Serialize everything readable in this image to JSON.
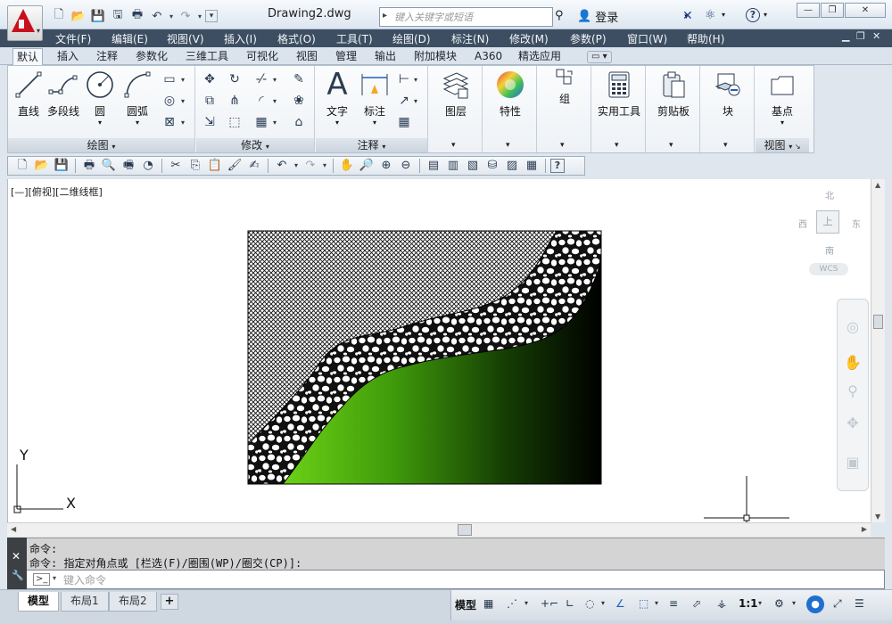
{
  "window": {
    "title": "Drawing2.dwg",
    "minimize": "—",
    "restore": "❐",
    "close": "✕"
  },
  "search": {
    "placeholder": "键入关键字或短语"
  },
  "user": {
    "login": "登录"
  },
  "menu": [
    "文件(F)",
    "编辑(E)",
    "视图(V)",
    "插入(I)",
    "格式(O)",
    "工具(T)",
    "绘图(D)",
    "标注(N)",
    "修改(M)",
    "参数(P)",
    "窗口(W)",
    "帮助(H)"
  ],
  "ribbon_tabs": [
    "默认",
    "插入",
    "注释",
    "参数化",
    "三维工具",
    "可视化",
    "视图",
    "管理",
    "输出",
    "附加模块",
    "A360",
    "精选应用"
  ],
  "ribbon": {
    "draw": {
      "title": "绘图",
      "line": "直线",
      "polyline": "多段线",
      "circle": "圆",
      "arc": "圆弧"
    },
    "modify": {
      "title": "修改"
    },
    "annotation": {
      "title": "注释",
      "text": "文字",
      "dimension": "标注"
    },
    "layers": "图层",
    "properties": "特性",
    "group": "组",
    "utilities": "实用工具",
    "clipboard": "剪贴板",
    "block": "块",
    "view": {
      "title": "视图",
      "basepoint": "基点"
    }
  },
  "viewport": {
    "label": "[—][俯视][二维线框]"
  },
  "viewcube": {
    "north": "北",
    "south": "南",
    "east": "东",
    "west": "西",
    "top": "上",
    "wcs": "WCS"
  },
  "command": {
    "line1": "命令:",
    "line2": "命令: 指定对角点或 [栏选(F)/圈围(WP)/圈交(CP)]:",
    "prompt_icon": ">_",
    "placeholder": "键入命令"
  },
  "layouts": {
    "model": "模型",
    "layout1": "布局1",
    "layout2": "布局2",
    "add": "+"
  },
  "status": {
    "model": "模型",
    "scale": "1:1"
  },
  "axes": {
    "x": "X",
    "y": "Y"
  },
  "colors": {
    "menu_bg": "#3d4e62",
    "gradient_green": "#6cd116",
    "gradient_black": "#000000",
    "logo_red": "#c8101c"
  }
}
